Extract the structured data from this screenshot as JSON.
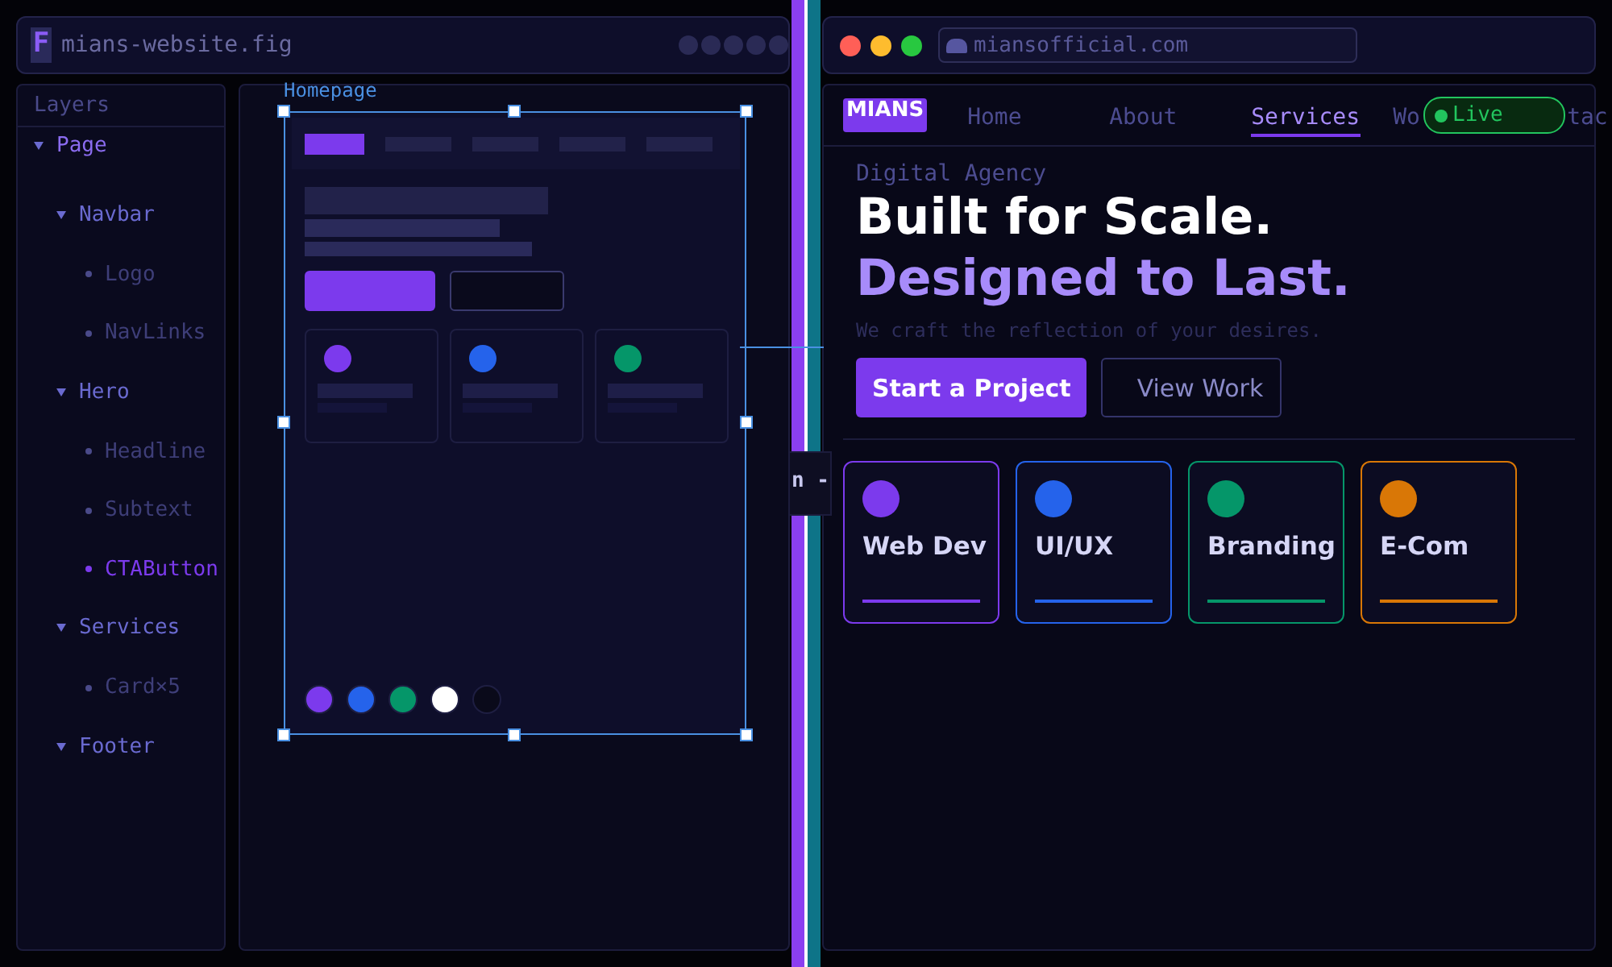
{
  "editor": {
    "logo": "F",
    "filename": "mians-website.fig",
    "layers": {
      "title": "Layers",
      "items": [
        {
          "label": "Page",
          "expanded": true,
          "selected": false,
          "children": [
            {
              "label": "Navbar",
              "expanded": true,
              "selected": false,
              "children": [
                {
                  "label": "Logo",
                  "selected": false
                },
                {
                  "label": "NavLinks",
                  "selected": false
                }
              ]
            },
            {
              "label": "Hero",
              "expanded": true,
              "selected": false,
              "children": [
                {
                  "label": "Headline",
                  "selected": false
                },
                {
                  "label": "Subtext",
                  "selected": false
                },
                {
                  "label": "CTAButton",
                  "selected": true
                }
              ]
            },
            {
              "label": "Services",
              "expanded": true,
              "selected": false,
              "children": [
                {
                  "label": "Card×5",
                  "selected": false
                }
              ]
            },
            {
              "label": "Footer",
              "expanded": true,
              "selected": false
            }
          ]
        }
      ]
    },
    "canvas": {
      "frame_label": "Homepage",
      "wire_cards": [
        {
          "color": "#7c3aed"
        },
        {
          "color": "#2563eb"
        },
        {
          "color": "#059669"
        }
      ],
      "swatches": [
        {
          "color": "#7c3aed"
        },
        {
          "color": "#2563eb"
        },
        {
          "color": "#059669"
        },
        {
          "color": "#ffffff"
        },
        {
          "color": "#0a0a1a"
        }
      ]
    }
  },
  "divider": {
    "tab": "n -"
  },
  "browser": {
    "url": "miansofficial.com",
    "site": {
      "logo": "MIANS",
      "nav": [
        {
          "label": "Home",
          "selected": false
        },
        {
          "label": "About",
          "selected": false
        },
        {
          "label": "Services",
          "selected": true
        },
        {
          "label": "Wo",
          "selected": false
        },
        {
          "label": "tac",
          "selected": false
        }
      ],
      "live_badge": "Live",
      "eyebrow": "Digital Agency",
      "headline": "Built for Scale.",
      "headline_accent": "Designed to Last.",
      "subtext": "We craft the reflection of your desires.",
      "buttons": [
        {
          "label": "Start a Project",
          "kind": "primary"
        },
        {
          "label": "View Work",
          "kind": "outline"
        }
      ],
      "cards": [
        {
          "title": "Web Dev",
          "color": "#7c3aed"
        },
        {
          "title": "UI/UX",
          "color": "#2563eb"
        },
        {
          "title": "Branding",
          "color": "#059669"
        },
        {
          "title": "E-Com",
          "color": "#d97706"
        }
      ]
    }
  }
}
